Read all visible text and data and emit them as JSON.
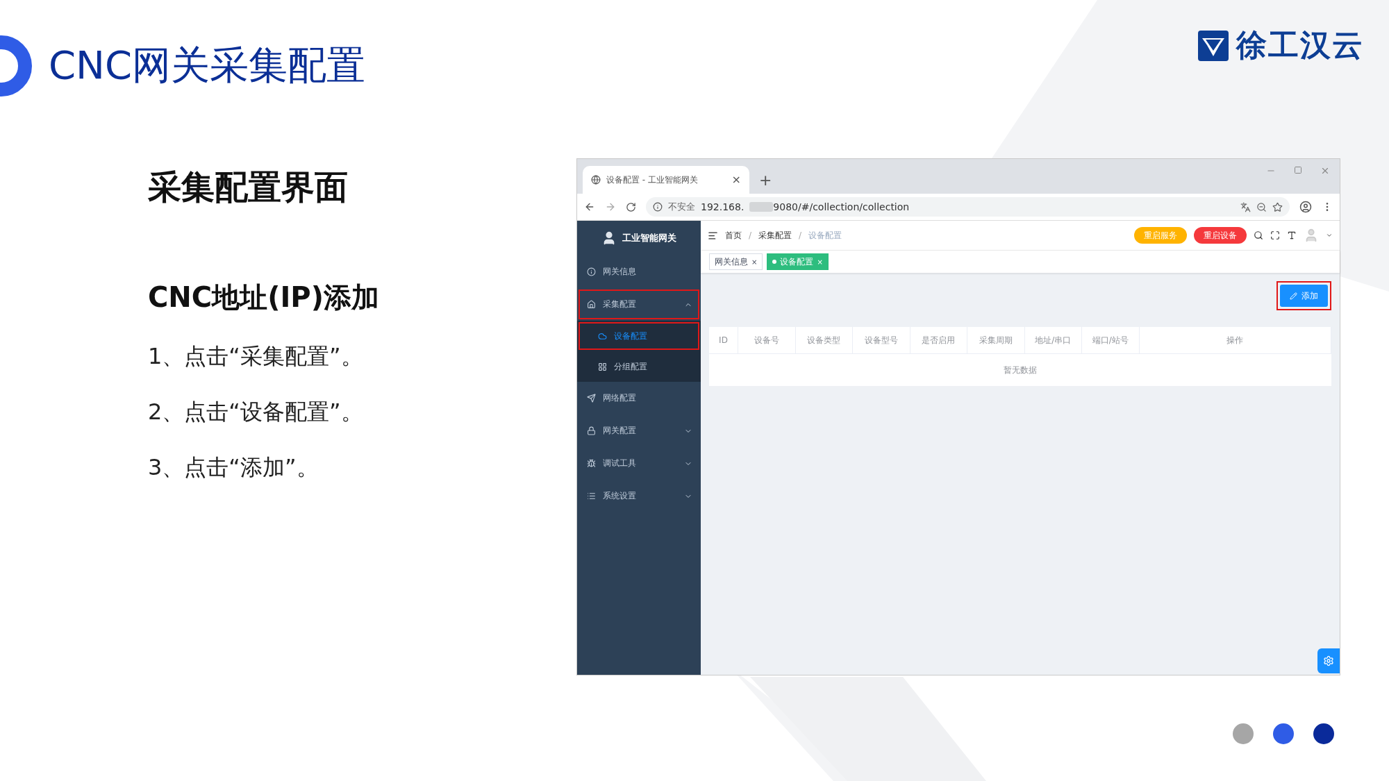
{
  "slide": {
    "title": "CNC网关采集配置",
    "logo": "徐工汉云",
    "heading": "采集配置界面",
    "subheading": "CNC地址(IP)添加",
    "steps": [
      "1、点击“采集配置”。",
      "2、点击“设备配置”。",
      "3、点击“添加”。"
    ],
    "dots": [
      {
        "color": "#a6a6a6"
      },
      {
        "color": "#2f5ce6"
      },
      {
        "color": "#0a2a9a"
      }
    ]
  },
  "browser": {
    "tab_title": "设备配置 - 工业智能网关",
    "tab_close": "×",
    "new_tab": "+",
    "security": "不安全",
    "url_start": "192.168.",
    "url_end": "9080/#/collection/collection"
  },
  "app": {
    "brand": "工业智能网关",
    "menu": [
      {
        "kind": "item",
        "label": "网关信息"
      },
      {
        "kind": "group",
        "label": "采集配置",
        "expanded": true,
        "highlighted": true,
        "children": [
          {
            "label": "设备配置",
            "selected": true,
            "highlighted": true
          },
          {
            "label": "分组配置",
            "selected": false,
            "highlighted": false
          }
        ]
      },
      {
        "kind": "item",
        "label": "网络配置"
      },
      {
        "kind": "group",
        "label": "网关配置",
        "expanded": false,
        "highlighted": false
      },
      {
        "kind": "group",
        "label": "调试工具",
        "expanded": false,
        "highlighted": false
      },
      {
        "kind": "group",
        "label": "系统设置",
        "expanded": false,
        "highlighted": false
      }
    ],
    "breadcrumb": [
      {
        "label": "首页",
        "current": false
      },
      {
        "separator": "/",
        "label": "采集配置",
        "current": false
      },
      {
        "separator": "/",
        "label": "设备配置",
        "current": true
      }
    ],
    "header_buttons": [
      {
        "label": "重启服务",
        "color": "#ffb300"
      },
      {
        "label": "重启设备",
        "color": "#f5393c"
      }
    ],
    "tags": [
      {
        "label": "网关信息",
        "selected": false,
        "close": "×"
      },
      {
        "label": "设备配置",
        "selected": true,
        "close": "×"
      }
    ],
    "add_button": {
      "label": "添加",
      "highlighted": true
    },
    "table": {
      "columns": [
        "ID",
        "设备号",
        "设备类型",
        "设备型号",
        "是否启用",
        "采集周期",
        "地址/串口",
        "端口/站号",
        "操作"
      ],
      "empty": "暂无数据"
    }
  }
}
